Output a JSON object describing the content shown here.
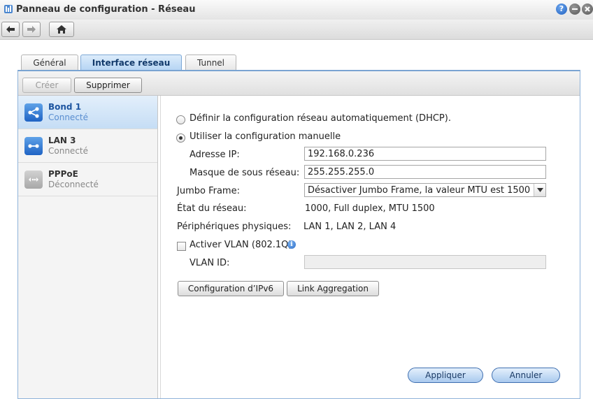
{
  "window": {
    "title": "Panneau de configuration - Réseau",
    "help_glyph": "?"
  },
  "tabs": [
    {
      "label": "Général"
    },
    {
      "label": "Interface réseau",
      "selected": true
    },
    {
      "label": "Tunnel"
    }
  ],
  "toolbar": {
    "create_label": "Créer",
    "delete_label": "Supprimer"
  },
  "interfaces": [
    {
      "name": "Bond 1",
      "status": "Connecté",
      "selected": true
    },
    {
      "name": "LAN 3",
      "status": "Connecté",
      "selected": false
    },
    {
      "name": "PPPoE",
      "status": "Déconnecté",
      "selected": false
    }
  ],
  "form": {
    "dhcp_label": "Définir la configuration réseau automatiquement (DHCP).",
    "dhcp_checked": false,
    "manual_label": "Utiliser la configuration manuelle",
    "manual_checked": true,
    "ip_label": "Adresse IP:",
    "ip_value": "192.168.0.236",
    "mask_label": "Masque de sous réseau:",
    "mask_value": "255.255.255.0",
    "jumbo_label": "Jumbo Frame:",
    "jumbo_value": "Désactiver Jumbo Frame, la valeur MTU est 1500",
    "state_label": "État du réseau:",
    "state_value": "1000, Full duplex, MTU 1500",
    "devices_label": "Périphériques physiques:",
    "devices_value": "LAN 1, LAN 2, LAN 4",
    "vlan_label": "Activer VLAN (802.1Q)",
    "vlan_checked": false,
    "vlan_info_glyph": "i",
    "vlan_id_label": "VLAN ID:",
    "vlan_id_value": "",
    "ipv6_button": "Configuration d’IPv6",
    "link_agg_button": "Link Aggregation"
  },
  "footer": {
    "apply_label": "Appliquer",
    "cancel_label": "Annuler"
  },
  "colors": {
    "accent": "#1f63c4",
    "selected_bg": "#c5ddf5",
    "tab_selected": "#b5d4f3"
  }
}
